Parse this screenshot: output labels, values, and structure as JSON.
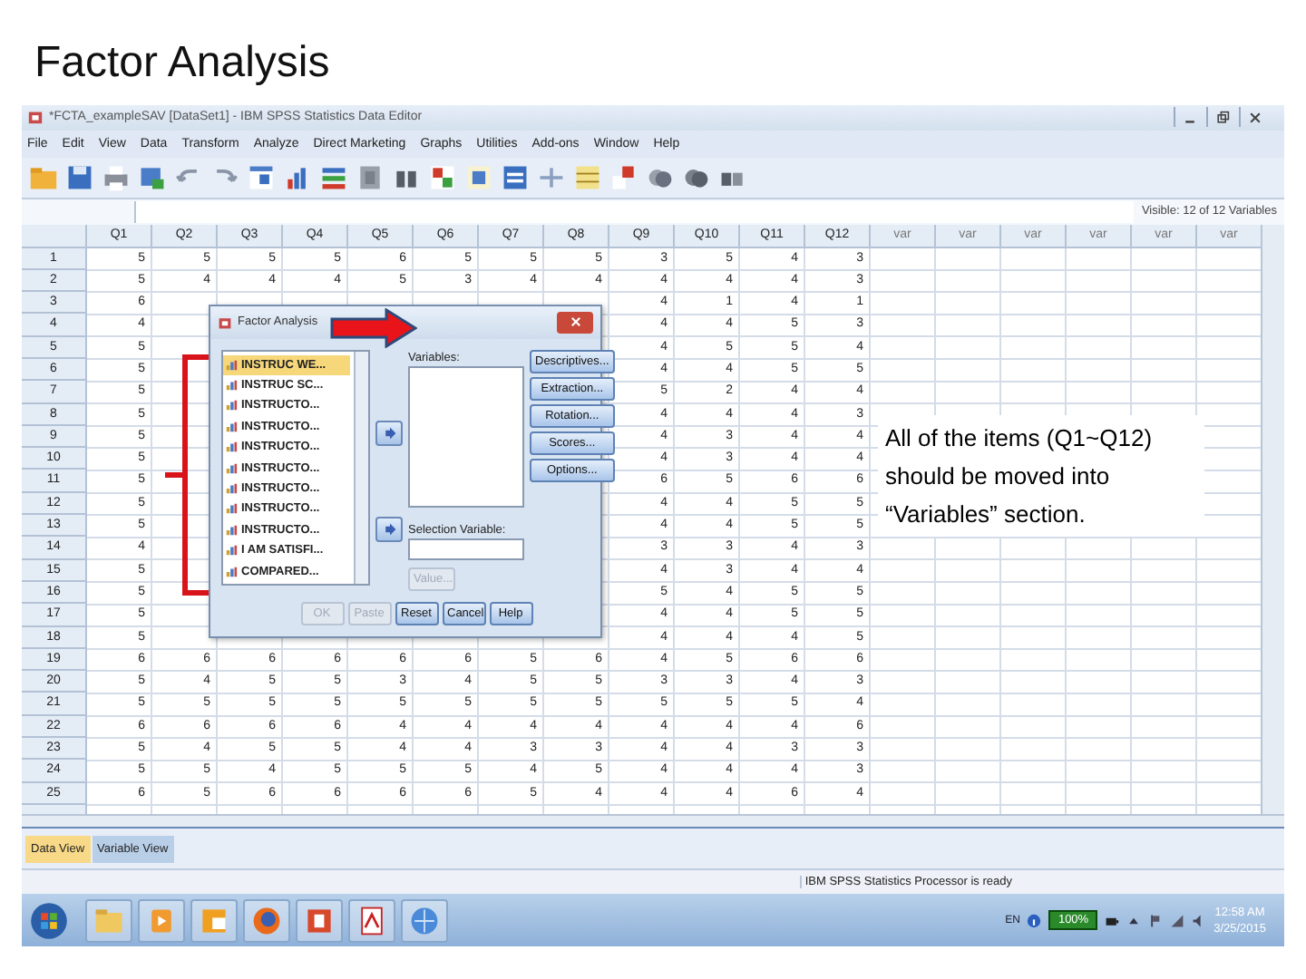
{
  "slide": {
    "title": "Factor Analysis",
    "note": "All of the items (Q1~Q12) should be moved into “Variables” section."
  },
  "window": {
    "title": "*FCTA_exampleSAV [DataSet1] - IBM SPSS Statistics Data Editor",
    "menu": [
      "File",
      "Edit",
      "View",
      "Data",
      "Transform",
      "Analyze",
      "Direct Marketing",
      "Graphs",
      "Utilities",
      "Add-ons",
      "Window",
      "Help"
    ],
    "visible_info": "Visible: 12 of 12 Variables"
  },
  "grid": {
    "columns": [
      "Q1",
      "Q2",
      "Q3",
      "Q4",
      "Q5",
      "Q6",
      "Q7",
      "Q8",
      "Q9",
      "Q10",
      "Q11",
      "Q12",
      "var",
      "var",
      "var",
      "var",
      "var",
      "var"
    ],
    "rows": [
      {
        "label": "1",
        "cells": [
          "5",
          "5",
          "5",
          "5",
          "6",
          "5",
          "5",
          "5",
          "3",
          "5",
          "4",
          "3"
        ]
      },
      {
        "label": "2",
        "cells": [
          "5",
          "4",
          "4",
          "4",
          "5",
          "3",
          "4",
          "4",
          "4",
          "4",
          "4",
          "3"
        ]
      },
      {
        "label": "3",
        "cells": [
          "6",
          null,
          null,
          null,
          null,
          null,
          null,
          null,
          "4",
          "1",
          "4",
          "1"
        ]
      },
      {
        "label": "4",
        "cells": [
          "4",
          null,
          null,
          null,
          null,
          null,
          null,
          null,
          "4",
          "4",
          "5",
          "3"
        ]
      },
      {
        "label": "5",
        "cells": [
          "5",
          null,
          null,
          null,
          null,
          null,
          null,
          null,
          "4",
          "5",
          "5",
          "4"
        ]
      },
      {
        "label": "6",
        "cells": [
          "5",
          null,
          null,
          null,
          null,
          null,
          null,
          null,
          "4",
          "4",
          "5",
          "5"
        ]
      },
      {
        "label": "7",
        "cells": [
          "5",
          null,
          null,
          null,
          null,
          null,
          null,
          null,
          "5",
          "2",
          "4",
          "4"
        ]
      },
      {
        "label": "8",
        "cells": [
          "5",
          null,
          null,
          null,
          null,
          null,
          null,
          null,
          "4",
          "4",
          "4",
          "3"
        ]
      },
      {
        "label": "9",
        "cells": [
          "5",
          null,
          null,
          null,
          null,
          null,
          null,
          null,
          "4",
          "3",
          "4",
          "4"
        ]
      },
      {
        "label": "10",
        "cells": [
          "5",
          null,
          null,
          null,
          null,
          null,
          null,
          null,
          "4",
          "3",
          "4",
          "4"
        ]
      },
      {
        "label": "11",
        "cells": [
          "5",
          null,
          null,
          null,
          null,
          null,
          null,
          null,
          "6",
          "5",
          "6",
          "6"
        ]
      },
      {
        "label": "12",
        "cells": [
          "5",
          null,
          null,
          null,
          null,
          null,
          null,
          null,
          "4",
          "4",
          "5",
          "5"
        ]
      },
      {
        "label": "13",
        "cells": [
          "5",
          null,
          null,
          null,
          null,
          null,
          null,
          null,
          "4",
          "4",
          "5",
          "5"
        ]
      },
      {
        "label": "14",
        "cells": [
          "4",
          null,
          null,
          null,
          null,
          null,
          null,
          null,
          "3",
          "3",
          "4",
          "3"
        ]
      },
      {
        "label": "15",
        "cells": [
          "5",
          null,
          null,
          null,
          null,
          null,
          null,
          null,
          "4",
          "3",
          "4",
          "4"
        ]
      },
      {
        "label": "16",
        "cells": [
          "5",
          null,
          null,
          null,
          null,
          null,
          null,
          null,
          "5",
          "4",
          "5",
          "5"
        ]
      },
      {
        "label": "17",
        "cells": [
          "5",
          null,
          null,
          null,
          null,
          null,
          null,
          null,
          "4",
          "4",
          "5",
          "5"
        ]
      },
      {
        "label": "18",
        "cells": [
          "5",
          null,
          null,
          null,
          null,
          null,
          null,
          null,
          "4",
          "4",
          "4",
          "5"
        ]
      },
      {
        "label": "19",
        "cells": [
          "6",
          "6",
          "6",
          "6",
          "6",
          "6",
          "5",
          "6",
          "4",
          "5",
          "6",
          "6"
        ]
      },
      {
        "label": "20",
        "cells": [
          "5",
          "4",
          "5",
          "5",
          "3",
          "4",
          "5",
          "5",
          "3",
          "3",
          "4",
          "3"
        ]
      },
      {
        "label": "21",
        "cells": [
          "5",
          "5",
          "5",
          "5",
          "5",
          "5",
          "5",
          "5",
          "5",
          "5",
          "5",
          "4"
        ]
      },
      {
        "label": "22",
        "cells": [
          "6",
          "6",
          "6",
          "6",
          "4",
          "4",
          "4",
          "4",
          "4",
          "4",
          "4",
          "6"
        ]
      },
      {
        "label": "23",
        "cells": [
          "5",
          "4",
          "5",
          "5",
          "4",
          "4",
          "3",
          "3",
          "4",
          "4",
          "3",
          "3"
        ]
      },
      {
        "label": "24",
        "cells": [
          "5",
          "5",
          "4",
          "5",
          "5",
          "5",
          "4",
          "5",
          "4",
          "4",
          "4",
          "3"
        ]
      },
      {
        "label": "25",
        "cells": [
          "6",
          "5",
          "6",
          "6",
          "6",
          "6",
          "5",
          "4",
          "4",
          "4",
          "6",
          "4"
        ]
      }
    ]
  },
  "view_tabs": [
    {
      "label": "Data View",
      "selected": true
    },
    {
      "label": "Variable View",
      "selected": false
    }
  ],
  "status": "IBM SPSS Statistics Processor is ready",
  "taskbar": {
    "language": "EN",
    "battery": "100%",
    "time": "12:58 AM",
    "date": "3/25/2015"
  },
  "dialog": {
    "title": "Factor Analysis",
    "source_items": [
      {
        "label": "INSTRUC WE...",
        "selected": true
      },
      {
        "label": "INSTRUC SC...",
        "selected": false
      },
      {
        "label": "INSTRUCTO...",
        "selected": false
      },
      {
        "label": "INSTRUCTO...",
        "selected": false
      },
      {
        "label": "INSTRUCTO...",
        "selected": false
      },
      {
        "label": "INSTRUCTO...",
        "selected": false
      },
      {
        "label": "INSTRUCTO...",
        "selected": false
      },
      {
        "label": "INSTRUCTO...",
        "selected": false
      },
      {
        "label": "INSTRUCTO...",
        "selected": false
      },
      {
        "label": "I AM SATISFI...",
        "selected": false
      },
      {
        "label": "COMPARED...",
        "selected": false
      }
    ],
    "variables_label": "Variables:",
    "selection_label": "Selection Variable:",
    "value_button": {
      "label": "Value...",
      "disabled": true
    },
    "side_buttons": [
      "Descriptives...",
      "Extraction...",
      "Rotation...",
      "Scores...",
      "Options..."
    ],
    "bottom_buttons": [
      {
        "label": "OK",
        "disabled": true
      },
      {
        "label": "Paste",
        "disabled": true
      },
      {
        "label": "Reset",
        "disabled": false
      },
      {
        "label": "Cancel",
        "disabled": false
      },
      {
        "label": "Help",
        "disabled": false
      }
    ]
  }
}
